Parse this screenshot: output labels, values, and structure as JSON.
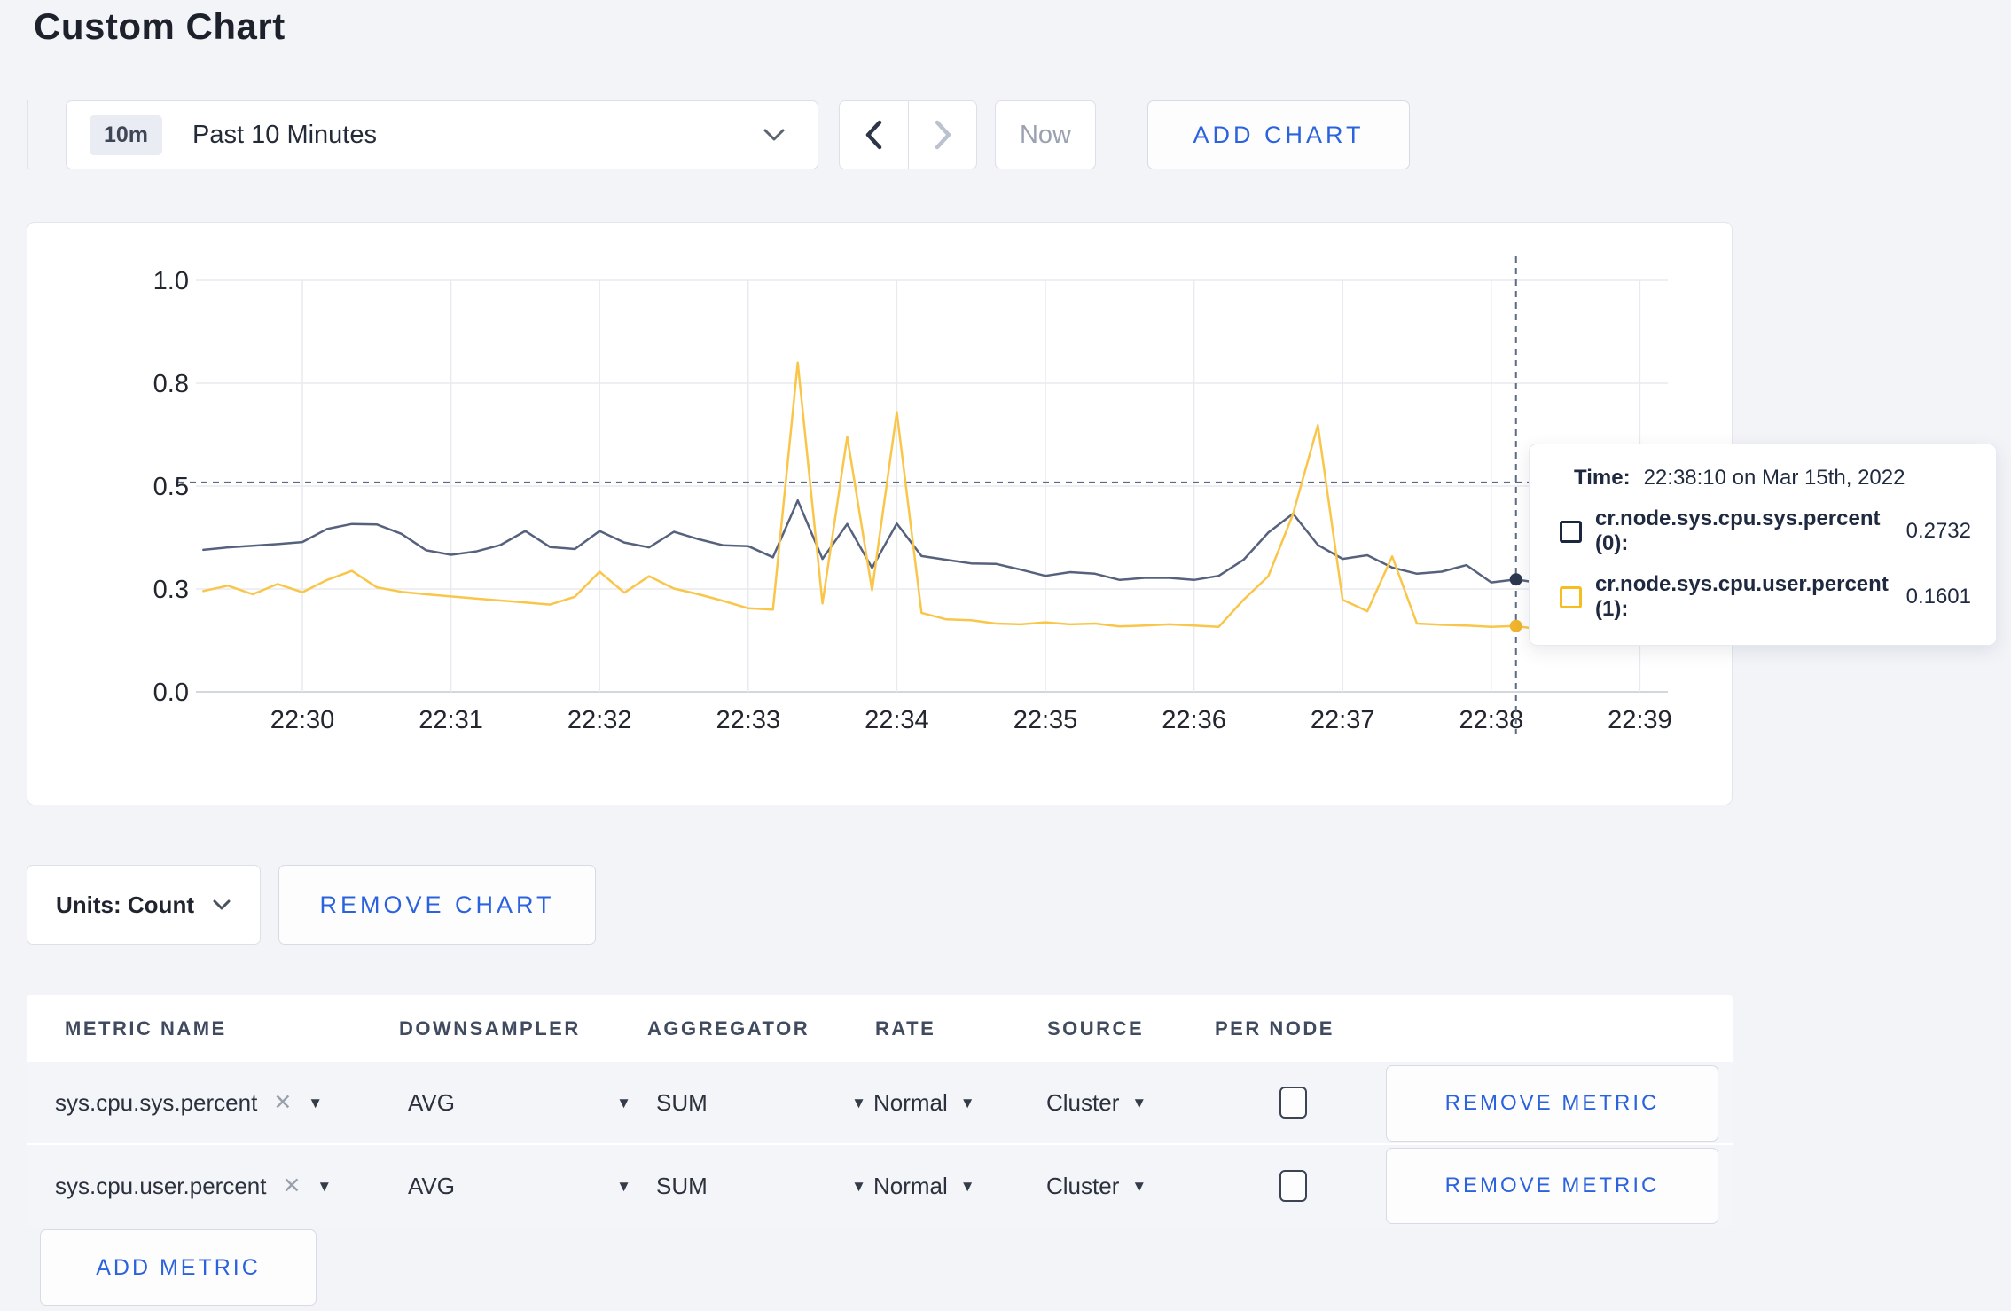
{
  "page": {
    "title": "Custom Chart"
  },
  "toolbar": {
    "range_badge": "10m",
    "range_label": "Past 10 Minutes",
    "now_label": "Now",
    "add_chart_label": "ADD CHART"
  },
  "tooltip": {
    "time_label": "Time:",
    "time_value": "22:38:10 on Mar 15th, 2022",
    "series": [
      {
        "label": "cr.node.sys.cpu.sys.percent (0):",
        "value": "0.2732",
        "color": "#1b2641"
      },
      {
        "label": "cr.node.sys.cpu.user.percent (1):",
        "value": "0.1601",
        "color": "#f5bd1f"
      }
    ]
  },
  "chart_footer": {
    "units_label": "Units: Count",
    "remove_chart_label": "REMOVE CHART"
  },
  "metrics_table": {
    "headers": [
      "METRIC NAME",
      "DOWNSAMPLER",
      "AGGREGATOR",
      "RATE",
      "SOURCE",
      "PER NODE"
    ],
    "rows": [
      {
        "metric": "sys.cpu.sys.percent",
        "downsampler": "AVG",
        "aggregator": "SUM",
        "rate": "Normal",
        "source": "Cluster",
        "per_node_checked": false,
        "remove_label": "REMOVE METRIC"
      },
      {
        "metric": "sys.cpu.user.percent",
        "downsampler": "AVG",
        "aggregator": "SUM",
        "rate": "Normal",
        "source": "Cluster",
        "per_node_checked": false,
        "remove_label": "REMOVE METRIC"
      }
    ],
    "add_metric_label": "ADD METRIC"
  },
  "chart_data": {
    "type": "line",
    "title": "",
    "xlabel": "",
    "ylabel": "",
    "grid": true,
    "legend_position": "none",
    "ylim": [
      0,
      1.07
    ],
    "y_tick_values": [
      0,
      0.25,
      0.5,
      0.75,
      1.0
    ],
    "y_tick_labels": [
      "0.0",
      "0.3",
      "0.5",
      "0.8",
      "1.0"
    ],
    "x_ticks": [
      "22:30",
      "22:31",
      "22:32",
      "22:33",
      "22:34",
      "22:35",
      "22:36",
      "22:37",
      "22:38",
      "22:39"
    ],
    "x_start": "22:29:20",
    "x_step_seconds": 10,
    "x_start_offset_seconds": -40,
    "series": [
      {
        "name": "cr.node.sys.cpu.sys.percent",
        "color": "#56627d",
        "dot_color": "#2c3850",
        "values": [
          0.345,
          0.351,
          0.355,
          0.359,
          0.364,
          0.396,
          0.408,
          0.407,
          0.384,
          0.344,
          0.333,
          0.341,
          0.357,
          0.391,
          0.352,
          0.347,
          0.391,
          0.363,
          0.351,
          0.389,
          0.371,
          0.356,
          0.354,
          0.327,
          0.465,
          0.323,
          0.408,
          0.301,
          0.409,
          0.33,
          0.321,
          0.312,
          0.311,
          0.297,
          0.282,
          0.291,
          0.287,
          0.272,
          0.277,
          0.277,
          0.272,
          0.282,
          0.321,
          0.387,
          0.433,
          0.357,
          0.323,
          0.332,
          0.302,
          0.287,
          0.292,
          0.308,
          0.266,
          0.2732,
          0.264,
          0.287,
          0.299,
          0.311,
          0.297,
          0.285
        ]
      },
      {
        "name": "cr.node.sys.cpu.user.percent",
        "color": "#f9c64a",
        "dot_color": "#f0b42e",
        "values": [
          0.245,
          0.258,
          0.237,
          0.262,
          0.242,
          0.272,
          0.294,
          0.254,
          0.243,
          0.237,
          0.232,
          0.227,
          0.222,
          0.217,
          0.212,
          0.231,
          0.292,
          0.241,
          0.281,
          0.251,
          0.237,
          0.221,
          0.203,
          0.2,
          0.8,
          0.215,
          0.62,
          0.247,
          0.68,
          0.192,
          0.176,
          0.174,
          0.166,
          0.164,
          0.169,
          0.164,
          0.166,
          0.159,
          0.161,
          0.164,
          0.161,
          0.158,
          0.224,
          0.281,
          0.432,
          0.648,
          0.224,
          0.196,
          0.329,
          0.166,
          0.163,
          0.161,
          0.158,
          0.1601,
          0.151,
          0.148,
          0.171,
          0.249,
          0.264,
          0.221
        ]
      }
    ],
    "hover": {
      "time": "22:38:10",
      "index": 53,
      "values": [
        0.2732,
        0.1601
      ],
      "crosshair_y_value": 0.509
    }
  }
}
